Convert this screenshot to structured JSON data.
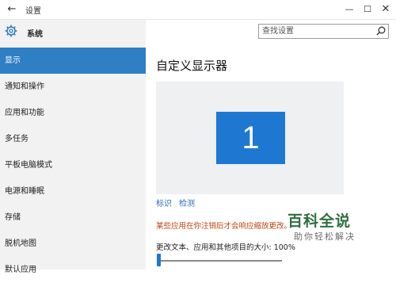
{
  "window": {
    "title": "设置",
    "back_icon": "back-arrow-icon",
    "minimize_glyph": "—",
    "maximize_glyph": "☐",
    "close_glyph": "✕"
  },
  "sidebar": {
    "header_label": "系统",
    "header_icon": "gear-icon",
    "items": [
      {
        "label": "显示",
        "active": true
      },
      {
        "label": "通知和操作",
        "active": false
      },
      {
        "label": "应用和功能",
        "active": false
      },
      {
        "label": "多任务",
        "active": false
      },
      {
        "label": "平板电脑模式",
        "active": false
      },
      {
        "label": "电源和睡眠",
        "active": false
      },
      {
        "label": "存储",
        "active": false
      },
      {
        "label": "脱机地图",
        "active": false
      },
      {
        "label": "默认应用",
        "active": false
      }
    ]
  },
  "search": {
    "placeholder": "查找设置",
    "icon": "search-icon"
  },
  "main": {
    "title": "自定义显示器",
    "monitor_number": "1",
    "links": {
      "identify": "标识",
      "detect": "检测"
    },
    "warning": "某些应用在你注销后才会响应缩放更改。",
    "scale_label": "更改文本、应用和其他项目的大小: 100%"
  },
  "watermark": {
    "logo": "百科全说",
    "subtitle": "助你轻松解决"
  },
  "colors": {
    "accent": "#2e7fc4",
    "monitor_fill": "#1e78d2",
    "warning": "#c2410c",
    "link": "#2a6fb5",
    "sidebar_bg": "#f2f2f2"
  }
}
